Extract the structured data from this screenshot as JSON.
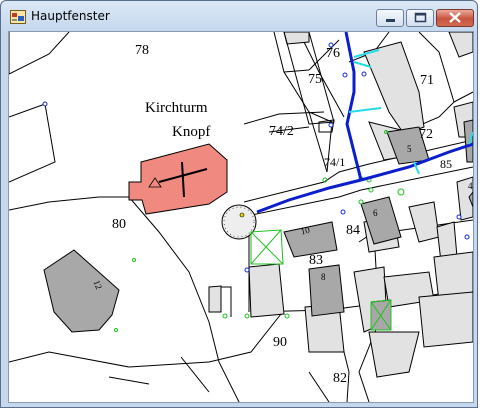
{
  "window": {
    "title": "Hauptfenster",
    "icons": {
      "app": "map-app-icon",
      "minimize": "minimize-icon",
      "maximize": "maximize-icon",
      "close": "close-icon"
    }
  },
  "map": {
    "labels": {
      "kirchturm": "Kirchturm",
      "knopf": "Knopf",
      "p78": "78",
      "p76": "76",
      "p75": "75",
      "p71": "71",
      "p742": "74/2",
      "p741": "74/1",
      "p72": "72",
      "p85": "85",
      "p80": "80",
      "p84": "84",
      "p83": "83",
      "p90": "90",
      "p82": "82",
      "b10": "10",
      "b6": "6",
      "b8": "8",
      "b5": "5",
      "b4": "4",
      "b12": "12"
    },
    "colors": {
      "church": "#f08a80",
      "building": "#a8a8a8",
      "building_light": "#e2e2e2",
      "pipe_main": "#0a1ecc",
      "pipe_branch": "#22dde8",
      "green": "#22c022"
    }
  }
}
